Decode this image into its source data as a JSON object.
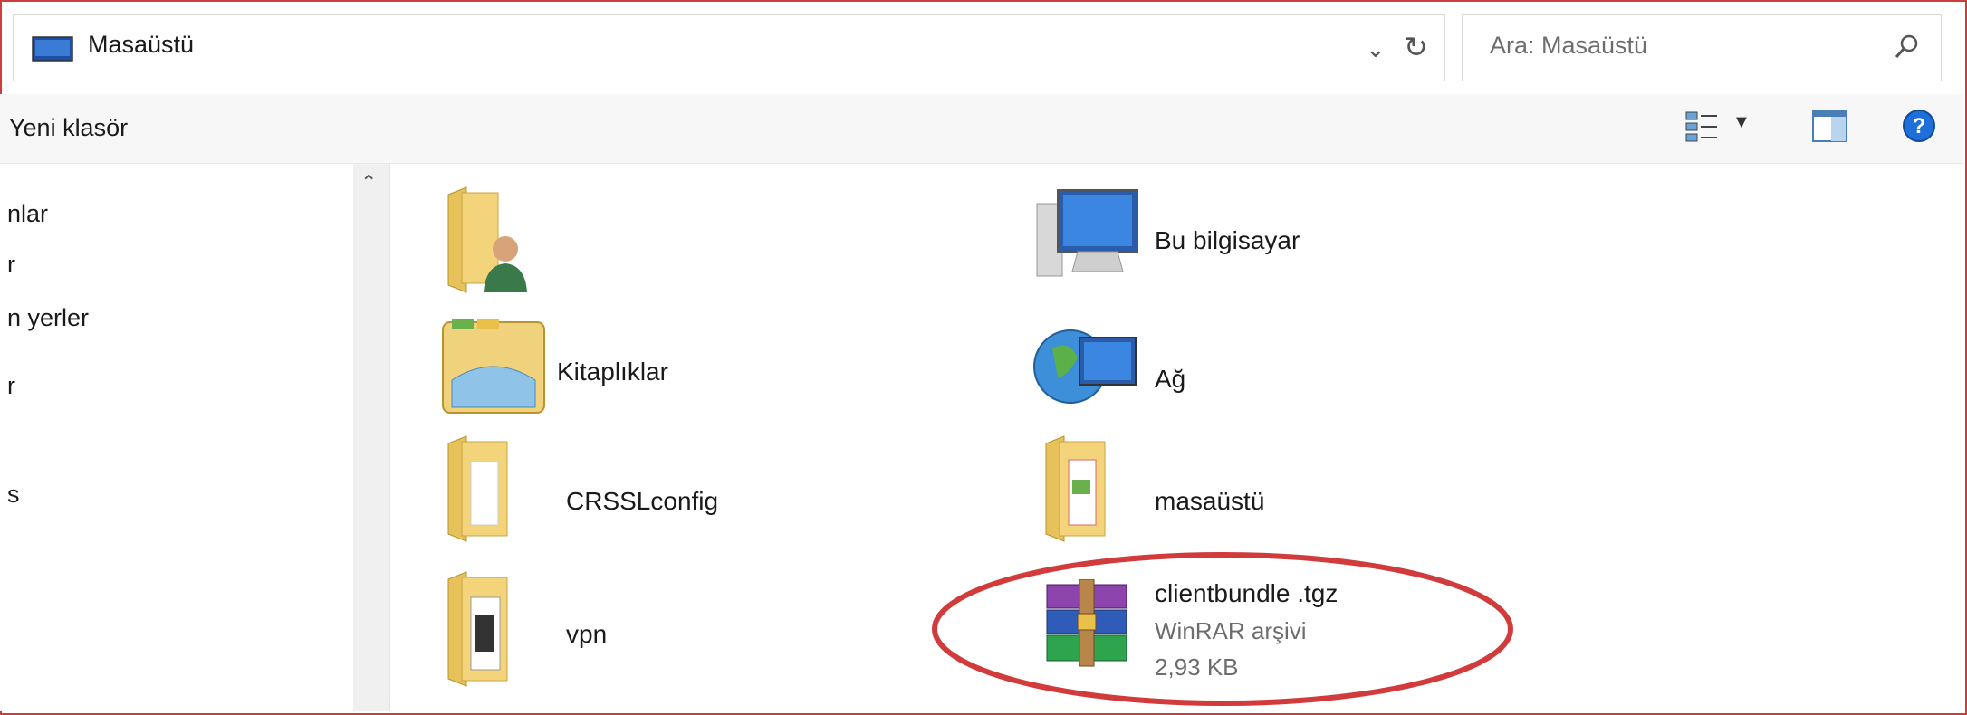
{
  "address": {
    "path": "Masaüstü"
  },
  "search": {
    "placeholder": "Ara: Masaüstü"
  },
  "toolbar": {
    "new_folder": "Yeni klasör"
  },
  "nav": {
    "items": [
      "nlar",
      "r",
      "n yerler",
      "r",
      "s"
    ]
  },
  "files": [
    {
      "name": "",
      "icon": "user-folder-icon"
    },
    {
      "name": "Bu bilgisayar",
      "icon": "computer-icon"
    },
    {
      "name": "Kitaplıklar",
      "icon": "libraries-icon"
    },
    {
      "name": "Ağ",
      "icon": "network-icon"
    },
    {
      "name": "CRSSLconfig",
      "icon": "folder-icon"
    },
    {
      "name": "masaüstü",
      "icon": "folder-icon"
    },
    {
      "name": "vpn",
      "icon": "folder-icon"
    },
    {
      "name": "clientbundle .tgz",
      "type": "WinRAR arşivi",
      "size": "2,93 KB",
      "icon": "winrar-archive-icon"
    }
  ],
  "colors": {
    "annotation_ring": "#d23b3b",
    "folder": "#f3d47a",
    "accent": "#1e6fd9"
  }
}
